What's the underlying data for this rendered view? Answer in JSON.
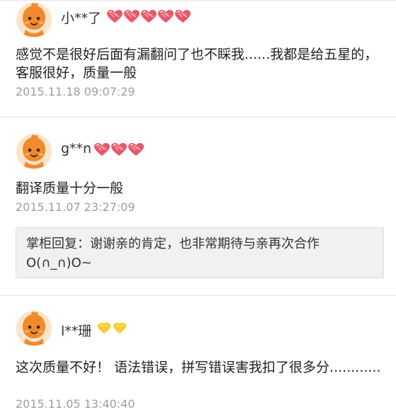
{
  "colors": {
    "timestamp": "#9e9e9e",
    "separator": "#e4e4e4",
    "reply_bg": "#f1f1f1",
    "heart_badge": "#e8586a",
    "diamond_badge": "#f5c518",
    "avatar": "#f08a2c"
  },
  "reviews": [
    {
      "username": "小**了",
      "badge_icon": "heart-badge-icon",
      "badge_count": 5,
      "content": "感觉不是很好后面有漏翻问了也不睬我......我都是给五星的，客服很好，质量一般",
      "timestamp": "2015.11.18 09:07:29"
    },
    {
      "username": "g**n",
      "badge_icon": "heart-badge-icon",
      "badge_count": 3,
      "content": "翻译质量十分一般",
      "timestamp": "2015.11.07 23:27:09",
      "reply": "掌柜回复：谢谢亲的肯定，也非常期待与亲再次合作O(∩_∩)O~"
    },
    {
      "username": "l**珊",
      "badge_icon": "diamond-badge-icon",
      "badge_count": 2,
      "content": "这次质量不好！ 语法错误，拼写错误害我扣了很多分............",
      "timestamp": "2015.11.05 13:40:40"
    }
  ]
}
